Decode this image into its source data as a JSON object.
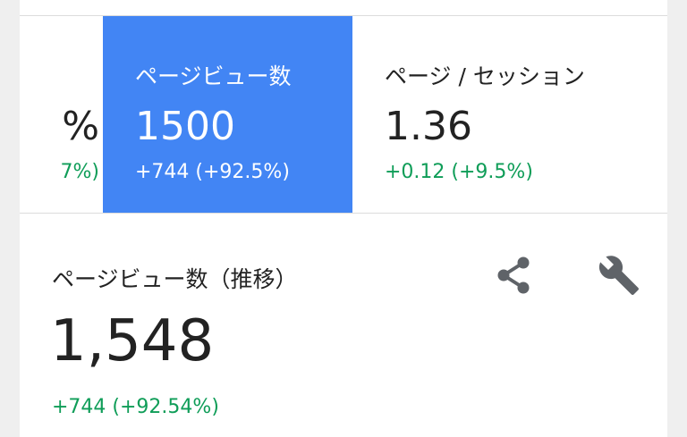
{
  "metrics": {
    "prev": {
      "value": "%",
      "change": "7%)"
    },
    "selected": {
      "label": "ページビュー数",
      "value": "1500",
      "change": "+744 (+92.5%)"
    },
    "next": {
      "label": "ページ / セッション",
      "value": "1.36",
      "change": "+0.12 (+9.5%)"
    }
  },
  "detail": {
    "title": "ページビュー数（推移）",
    "value": "1,548",
    "change": "+744 (+92.54%)",
    "icons": {
      "share": "share-icon",
      "settings": "wrench-icon"
    }
  },
  "colors": {
    "selected_tile": "#4285f4",
    "positive_change": "#0f9d58",
    "icon": "#5f6368"
  }
}
